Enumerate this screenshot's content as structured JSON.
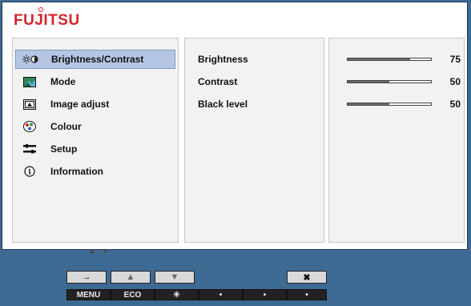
{
  "brand": {
    "name": "FUJITSU",
    "color": "#d8222a"
  },
  "menu": {
    "items": [
      {
        "label": "Brightness/Contrast",
        "icon": "brightness-contrast-icon",
        "selected": true
      },
      {
        "label": "Mode",
        "icon": "mode-icon",
        "selected": false
      },
      {
        "label": "Image adjust",
        "icon": "image-adjust-icon",
        "selected": false
      },
      {
        "label": "Colour",
        "icon": "colour-icon",
        "selected": false
      },
      {
        "label": "Setup",
        "icon": "setup-icon",
        "selected": false
      },
      {
        "label": "Information",
        "icon": "information-icon",
        "selected": false
      }
    ],
    "scroll_hint": "▲ ▼"
  },
  "parameters": [
    {
      "label": "Brightness",
      "value": "75",
      "level_percent": 75
    },
    {
      "label": "Contrast",
      "value": "50",
      "level_percent": 50
    },
    {
      "label": "Black level",
      "value": "50",
      "level_percent": 50
    }
  ],
  "buttons": {
    "top_row": [
      "→",
      "▲",
      "▼",
      "",
      "",
      "✖"
    ],
    "labels": [
      "MENU",
      "ECO",
      "✳",
      "•",
      "•",
      "•"
    ]
  },
  "colors": {
    "background": "#3d6a93",
    "selection": "#b4c6e4",
    "panel": "#f2f2f2"
  }
}
